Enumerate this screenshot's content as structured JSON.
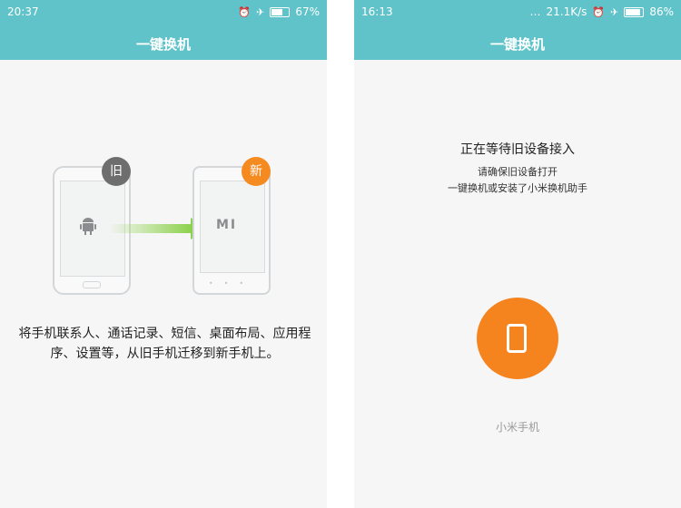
{
  "left": {
    "status": {
      "time": "20:37",
      "battery": "67%",
      "battery_level": 0.67
    },
    "title": "一键换机",
    "badge_old": "旧",
    "badge_new": "新",
    "description": "将手机联系人、通话记录、短信、桌面布局、应用程序、设置等，从旧手机迁移到新手机上。",
    "icons": [
      "android-icon",
      "mi-logo",
      "arrow-right-icon"
    ]
  },
  "right": {
    "status": {
      "time": "16:13",
      "speed": "21.1K/s",
      "battery": "86%",
      "battery_level": 0.86
    },
    "title": "一键换机",
    "waiting_title": "正在等待旧设备接入",
    "waiting_sub1": "请确保旧设备打开",
    "waiting_sub2": "一键换机或安装了小米换机助手",
    "device_name": "小米手机"
  },
  "colors": {
    "header": "#5fc3c9",
    "orange": "#f58a21",
    "gray_badge": "#6e6e6e",
    "arrow": "#8cd14a"
  }
}
